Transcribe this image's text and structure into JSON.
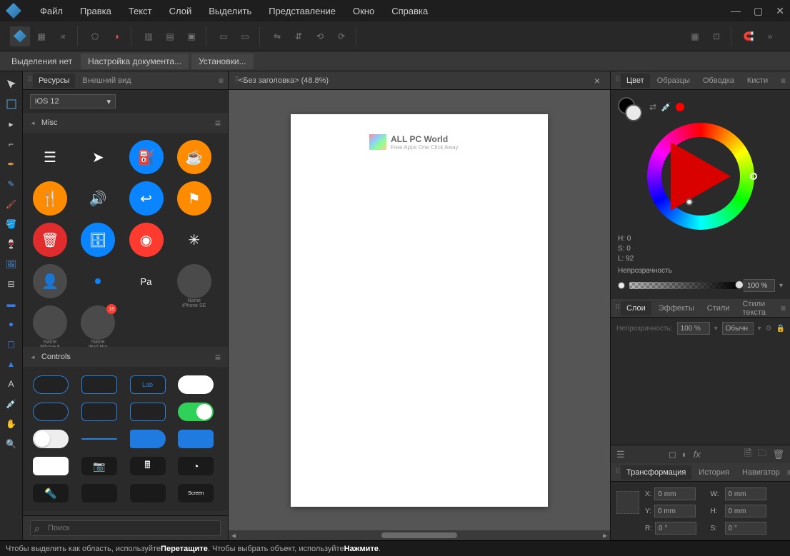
{
  "menubar": {
    "items": [
      "Файл",
      "Правка",
      "Текст",
      "Слой",
      "Выделить",
      "Представление",
      "Окно",
      "Справка"
    ]
  },
  "context_bar": {
    "selection_status": "Выделения нет",
    "doc_setup": "Настройка документа...",
    "preferences": "Установки..."
  },
  "assets_panel": {
    "tabs": {
      "resources": "Ресурсы",
      "appearance": "Внешний вид"
    },
    "preset": "iOS 12",
    "sections": {
      "misc": "Misc",
      "controls": "Controls"
    },
    "search_placeholder": "Поиск",
    "controls_label_text": "Lab"
  },
  "document": {
    "tab_title": "<Без заголовка> (48.8%)",
    "watermark_title": "ALL PC World",
    "watermark_sub": "Free Apps One Click Away"
  },
  "color_panel": {
    "tabs": {
      "color": "Цвет",
      "swatches": "Образцы",
      "stroke": "Обводка",
      "brushes": "Кисти"
    },
    "hsl": {
      "h_label": "H: 0",
      "s_label": "S: 0",
      "l_label": "L: 92"
    },
    "opacity_label": "Непрозрачность",
    "opacity_value": "100 %"
  },
  "layers_panel": {
    "tabs": {
      "layers": "Слои",
      "effects": "Эффекты",
      "styles": "Стили",
      "text_styles": "Стили текста"
    },
    "opacity_label": "Непрозрачность:",
    "opacity_value": "100 %",
    "blend_mode": "Обычн"
  },
  "transform_panel": {
    "tabs": {
      "transform": "Трансформация",
      "history": "История",
      "navigator": "Навигатор"
    },
    "fields": {
      "x_label": "X:",
      "x_value": "0 mm",
      "y_label": "Y:",
      "y_value": "0 mm",
      "w_label": "W:",
      "w_value": "0 mm",
      "h_label": "H:",
      "h_value": "0 mm",
      "r_label": "R:",
      "r_value": "0 °",
      "s_label": "S:",
      "s_value": "0 °"
    }
  },
  "statusbar": {
    "pre1": "Чтобы выделить как область, используйте ",
    "b1": "Перетащите",
    "mid": ". Чтобы выбрать объект, используйте ",
    "b2": "Нажмите",
    "post": "."
  }
}
